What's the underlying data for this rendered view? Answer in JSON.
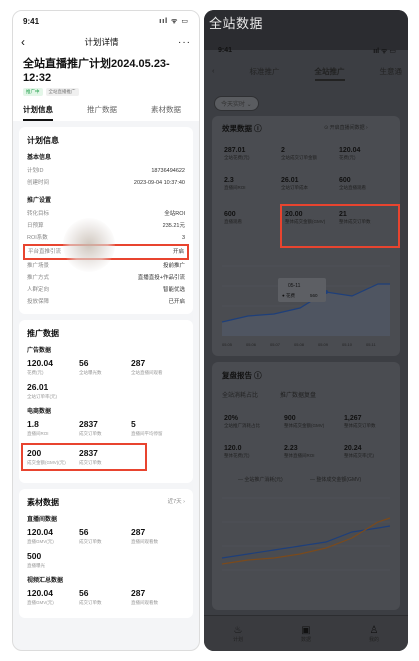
{
  "left": {
    "status": {
      "time": "9:41",
      "signal": "ııl ᯤ ▭"
    },
    "nav": {
      "back": "‹",
      "title": "计划详情",
      "more": "···"
    },
    "plan_title": "全站直播推广计划2024.05.23-12:32",
    "tags": [
      "推广中",
      "全站直播推广"
    ],
    "tabs": [
      "计划信息",
      "推广数据",
      "素材数据"
    ],
    "plan_info": {
      "title": "计划信息",
      "basic": {
        "heading": "基本信息",
        "rows": [
          {
            "k": "计划ID",
            "v": "18736494622"
          },
          {
            "k": "创建时间",
            "v": "2023-09-04 10:37:40"
          }
        ]
      },
      "settings": {
        "heading": "推广设置",
        "rows": [
          {
            "k": "转化目标",
            "v": "全站ROI"
          },
          {
            "k": "日预算",
            "v": "235.21元"
          },
          {
            "k": "ROI系数",
            "v": "3"
          },
          {
            "k": "平台直推引流",
            "v": "开启"
          },
          {
            "k": "推广场景",
            "v": "投前推广"
          },
          {
            "k": "推广方式",
            "v": "直播直投+作品引流"
          },
          {
            "k": "人群定向",
            "v": "智能优选"
          },
          {
            "k": "投放保障",
            "v": "已开启"
          }
        ]
      }
    },
    "promo_data": {
      "title": "推广数据",
      "ad": {
        "heading": "广告数据",
        "metrics": [
          {
            "num": "120.04",
            "lab": "花费(元)"
          },
          {
            "num": "56",
            "lab": "全站曝光数"
          },
          {
            "num": "287",
            "lab": "全站直播间观看"
          },
          {
            "num": "26.01",
            "lab": "全站订单率(元)"
          }
        ]
      },
      "ecom": {
        "heading": "电商数据",
        "metrics": [
          {
            "num": "1.8",
            "lab": "直播间ROI"
          },
          {
            "num": "2837",
            "lab": "成交订单数"
          },
          {
            "num": "5",
            "lab": "直播间平均停留"
          }
        ],
        "metrics_hl": [
          {
            "num": "200",
            "lab": "成交金额(GMV)(元)"
          },
          {
            "num": "2837",
            "lab": "成交订单数"
          }
        ]
      }
    },
    "material": {
      "title": "素材数据",
      "range": "近7天 ›",
      "live": {
        "heading": "直播间数据",
        "metrics": [
          {
            "num": "120.04",
            "lab": "直播GMV(元)"
          },
          {
            "num": "56",
            "lab": "成交订单数"
          },
          {
            "num": "287",
            "lab": "直播间观看数"
          },
          {
            "num": "500",
            "lab": "直播曝光"
          }
        ]
      },
      "video": {
        "heading": "视频汇总数据",
        "metrics": [
          {
            "num": "120.04",
            "lab": "直播GMV(元)"
          },
          {
            "num": "56",
            "lab": "成交订单数"
          },
          {
            "num": "287",
            "lab": "直播间观看数"
          }
        ]
      }
    }
  },
  "right": {
    "banner_title": "全站数据",
    "status": {
      "time": "9:41",
      "signal": "ııl ᯤ ▭"
    },
    "nav": [
      "‹",
      "标准推广",
      "全站推广",
      "生意通"
    ],
    "pill": "今天实时 ⌄",
    "effect": {
      "title": "效果数据 ⓘ",
      "link": "⊙ 开启直播间数据 ›",
      "metrics": [
        {
          "num": "287.01",
          "lab": "全站花费(元)"
        },
        {
          "num": "2",
          "lab": "全站成交订单金额"
        },
        {
          "num": "120.04",
          "lab": "花费(元)"
        },
        {
          "num": "2.3",
          "lab": "直播间ROI"
        },
        {
          "num": "26.01",
          "lab": "全站订单成本"
        },
        {
          "num": "600",
          "lab": "全站直播观看"
        },
        {
          "num": "600",
          "lab": "直播观看"
        },
        {
          "num": "20.00",
          "lab": "整体成交金额(GMV)"
        },
        {
          "num": "21",
          "lab": "整体成交订单数"
        }
      ],
      "tooltip": {
        "date": "05-11",
        "series": "● 花费",
        "value": "560"
      },
      "x_labels": [
        "05.05",
        "05.06",
        "05.07",
        "05.08",
        "05.09",
        "05.10",
        "05.11"
      ]
    },
    "review": {
      "title": "复盘报告 ⓘ",
      "tabs": [
        "全站消耗占比",
        "推广数据复盘"
      ],
      "metrics": [
        {
          "num": "20%",
          "lab": "全站推广消耗占比"
        },
        {
          "num": "900",
          "lab": "整体成交金额(GMV)"
        },
        {
          "num": "1,267",
          "lab": "整体成交订单数"
        },
        {
          "num": "120.0",
          "lab": "整体花费(元)"
        },
        {
          "num": "2.23",
          "lab": "整体直播间ROI"
        },
        {
          "num": "20.24",
          "lab": "整体成交率(元)"
        }
      ],
      "legend": [
        "— 全站推广消耗(元)",
        "— 整体成交金额(GMV)"
      ]
    },
    "footer": [
      {
        "icon": "♨",
        "label": "计划"
      },
      {
        "icon": "▣",
        "label": "数据"
      },
      {
        "icon": "♙",
        "label": "我的"
      }
    ]
  }
}
